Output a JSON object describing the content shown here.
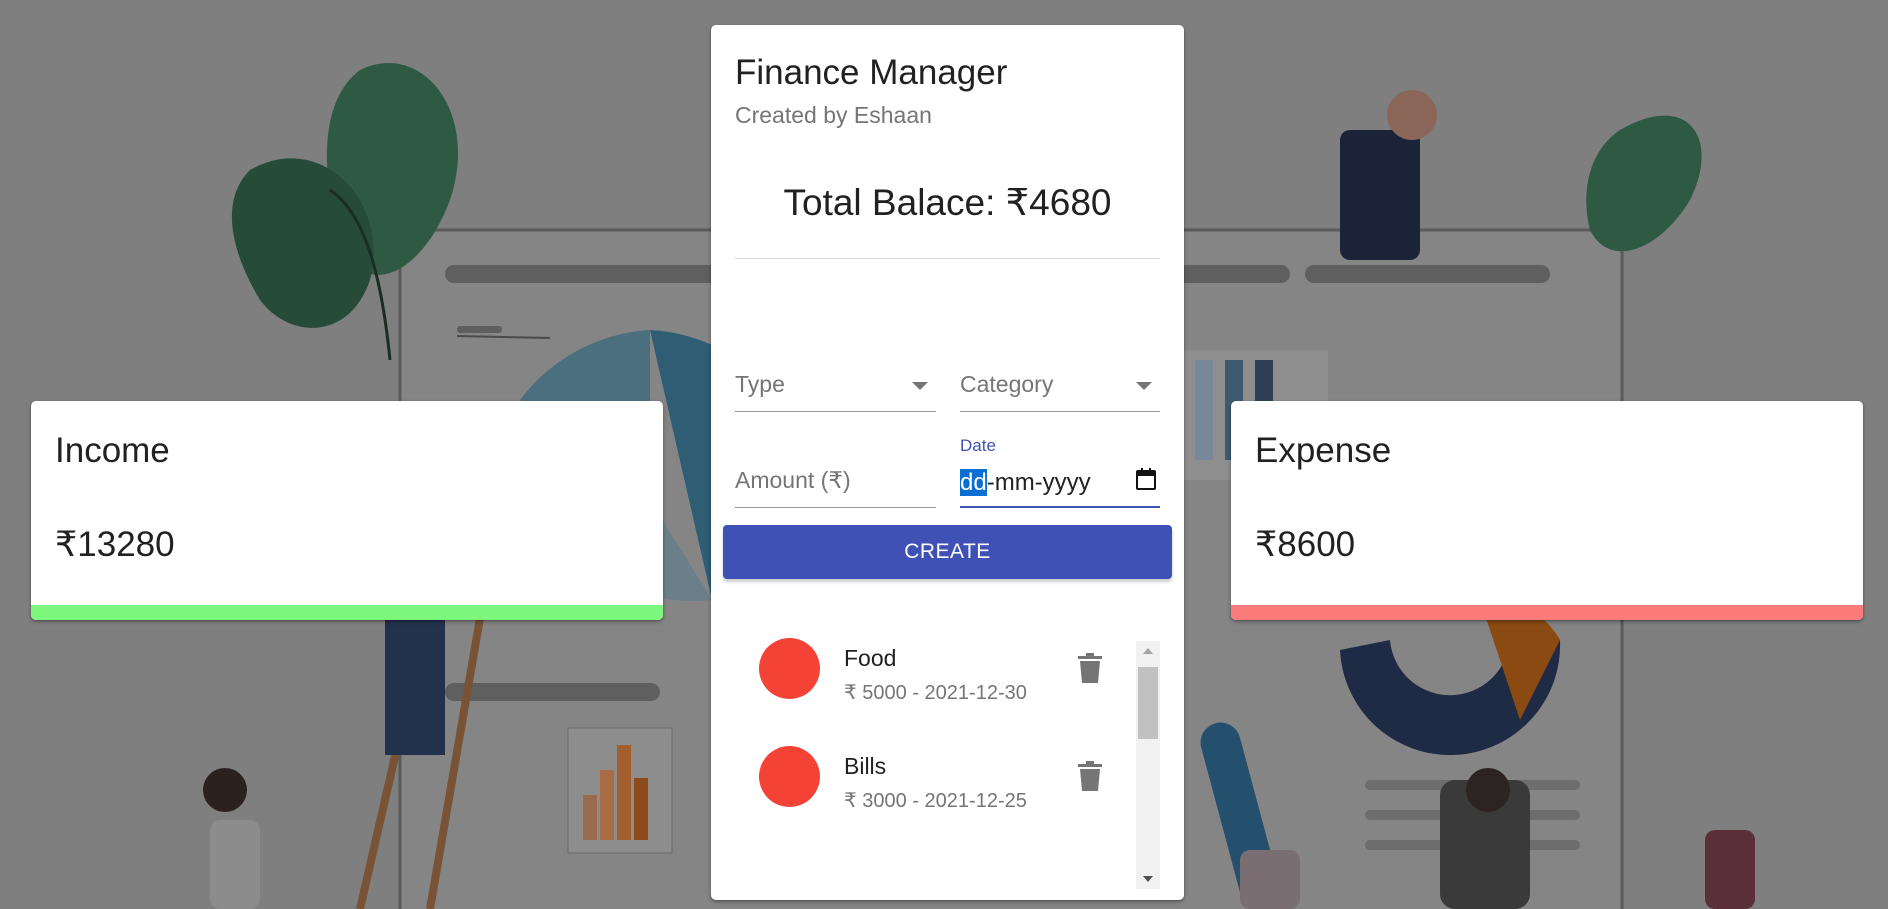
{
  "app": {
    "title": "Finance Manager",
    "subtitle": "Created by Eshaan",
    "balance_label": "Total Balace: ₹4680"
  },
  "income": {
    "title": "Income",
    "amount": "₹13280",
    "bar_color": "#7df87d"
  },
  "expense": {
    "title": "Expense",
    "amount": "₹8600",
    "bar_color": "#fb7a7a"
  },
  "form": {
    "type_placeholder": "Type",
    "category_placeholder": "Category",
    "amount_placeholder": "Amount (₹)",
    "date_label": "Date",
    "date_value_selected": "dd",
    "date_value_rest": "-mm-yyyy",
    "create_label": "CREATE"
  },
  "transactions": [
    {
      "category": "Food",
      "detail": "₹ 5000 - 2021-12-30",
      "avatar_color": "#f44336",
      "icon": "delete-icon"
    },
    {
      "category": "Bills",
      "detail": "₹ 3000 - 2021-12-25",
      "avatar_color": "#f44336",
      "icon": "delete-icon"
    }
  ],
  "colors": {
    "primary": "#3f51b5",
    "expense_avatar": "#f44336"
  }
}
